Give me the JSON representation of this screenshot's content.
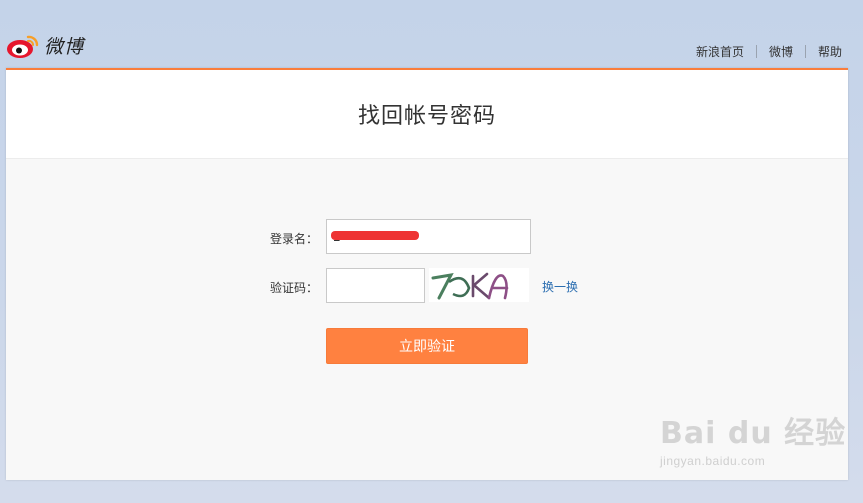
{
  "header": {
    "logo_text": "微博",
    "nav": [
      "新浪首页",
      "微博",
      "帮助"
    ]
  },
  "panel": {
    "title": "找回帐号密码"
  },
  "form": {
    "username_label": "登录名：",
    "username_value": "1",
    "captcha_label": "验证码：",
    "captcha_value": "",
    "captcha_text": "7OKA",
    "refresh_label": "换一换",
    "submit_label": "立即验证"
  },
  "watermark": {
    "main": "Bai du 经验",
    "sub": "jingyan.baidu.com"
  },
  "colors": {
    "accent": "#ff8140",
    "link": "#2a6db0",
    "background": "#c4d3e9"
  }
}
